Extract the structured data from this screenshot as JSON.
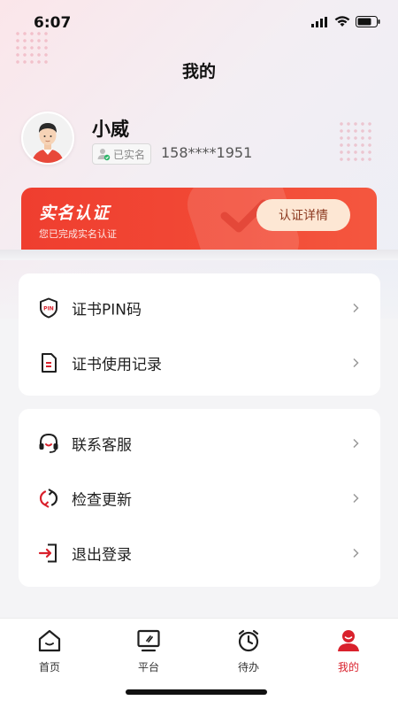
{
  "status_bar": {
    "time": "6:07"
  },
  "header": {
    "title": "我的"
  },
  "profile": {
    "name": "小威",
    "verified_label": "已实名",
    "phone": "158****1951"
  },
  "auth_card": {
    "title": "实名认证",
    "subtitle": "您已完成实名认证",
    "button_label": "认证详情"
  },
  "menu_group_1": [
    {
      "label": "证书PIN码",
      "icon": "pin-shield-icon"
    },
    {
      "label": "证书使用记录",
      "icon": "document-icon"
    }
  ],
  "menu_group_2": [
    {
      "label": "联系客服",
      "icon": "headset-icon"
    },
    {
      "label": "检查更新",
      "icon": "refresh-icon"
    },
    {
      "label": "退出登录",
      "icon": "logout-icon"
    }
  ],
  "tabs": [
    {
      "label": "首页",
      "icon": "home-icon",
      "active": false
    },
    {
      "label": "平台",
      "icon": "monitor-icon",
      "active": false
    },
    {
      "label": "待办",
      "icon": "alarm-clock-icon",
      "active": false
    },
    {
      "label": "我的",
      "icon": "profile-icon",
      "active": true
    }
  ],
  "colors": {
    "accent": "#d9212c",
    "auth_card": "#ef3e2f",
    "auth_button_bg": "#fde7d4"
  }
}
